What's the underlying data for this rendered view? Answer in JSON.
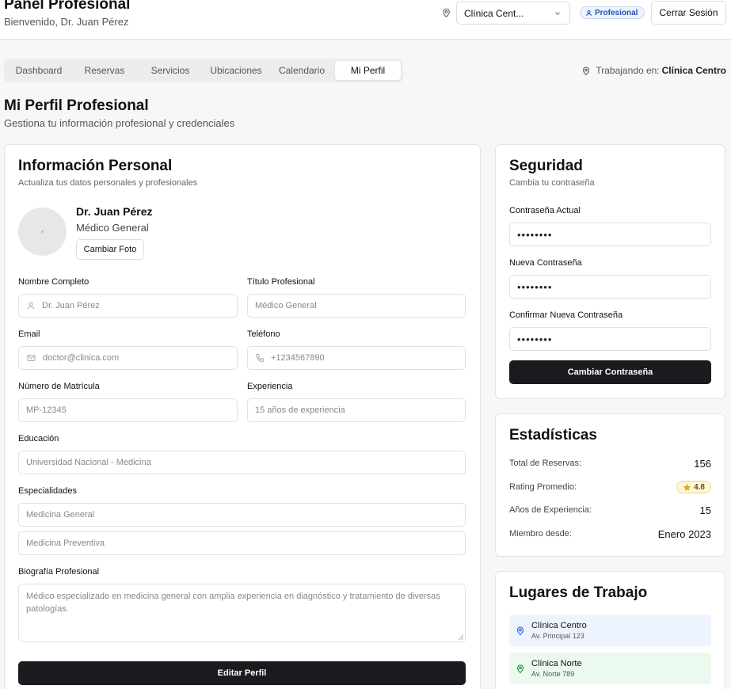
{
  "header": {
    "title": "Panel Profesional",
    "welcome": "Bienvenido, Dr. Juan Pérez",
    "clinic_selected": "Clínica Cent...",
    "role_badge": "Profesional",
    "logout_label": "Cerrar Sesión"
  },
  "tabs": [
    {
      "label": "Dashboard"
    },
    {
      "label": "Reservas"
    },
    {
      "label": "Servicios"
    },
    {
      "label": "Ubicaciones"
    },
    {
      "label": "Calendario"
    },
    {
      "label": "Mi Perfil"
    }
  ],
  "working": {
    "prefix": "Trabajando en:",
    "clinic": "Clínica Centro"
  },
  "page": {
    "title": "Mi Perfil Profesional",
    "subtitle": "Gestiona tu información profesional y credenciales"
  },
  "personal": {
    "title": "Información Personal",
    "subtitle": "Actualiza tus datos personales y profesionales",
    "name": "Dr. Juan Pérez",
    "specialty": "Médico General",
    "change_photo": "Cambiar Foto",
    "fields": {
      "full_name": {
        "label": "Nombre Completo",
        "value": "Dr. Juan Pérez"
      },
      "prof_title": {
        "label": "Título Profesional",
        "value": "Médico General"
      },
      "email": {
        "label": "Email",
        "value": "doctor@clinica.com"
      },
      "phone": {
        "label": "Teléfono",
        "value": "+1234567890"
      },
      "license": {
        "label": "Número de Matrícula",
        "value": "MP-12345"
      },
      "experience": {
        "label": "Experiencia",
        "value": "15 años de experiencia"
      },
      "education": {
        "label": "Educación",
        "value": "Universidad Nacional - Medicina"
      },
      "specialties": {
        "label": "Especialidades",
        "values": [
          "Medicina General",
          "Medicina Preventiva"
        ]
      },
      "bio": {
        "label": "Biografía Profesional",
        "value": "Médico especializado en medicina general con amplia experiencia en diagnóstico y tratamiento de diversas patologías."
      }
    },
    "edit_button": "Editar Perfil"
  },
  "security": {
    "title": "Seguridad",
    "subtitle": "Cambia tu contraseña",
    "current_label": "Contraseña Actual",
    "new_label": "Nueva Contraseña",
    "confirm_label": "Confirmar Nueva Contraseña",
    "masked": "••••••••",
    "button": "Cambiar Contraseña"
  },
  "stats": {
    "title": "Estadísticas",
    "rows": [
      {
        "label": "Total de Reservas:",
        "value": "156"
      },
      {
        "label": "Rating Promedio:",
        "value": "4.8"
      },
      {
        "label": "Años de Experiencia:",
        "value": "15"
      },
      {
        "label": "Miembro desde:",
        "value": "Enero 2023"
      }
    ]
  },
  "places": {
    "title": "Lugares de Trabajo",
    "items": [
      {
        "name": "Clínica Centro",
        "address": "Av. Principal 123",
        "color": "#eef4fd",
        "icon_color": "#2f6fe0"
      },
      {
        "name": "Clínica Norte",
        "address": "Av. Norte 789",
        "color": "#ebf9ee",
        "icon_color": "#22a04b"
      }
    ]
  }
}
